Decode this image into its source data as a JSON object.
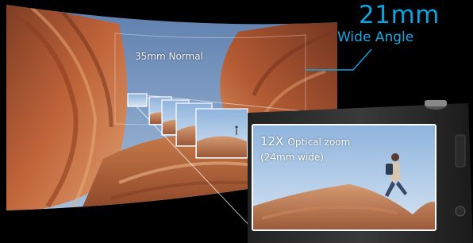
{
  "wide_angle": {
    "focal": "21mm",
    "label": "Wide Angle"
  },
  "normal": {
    "label": "35mm Normal"
  },
  "zoom": {
    "magnification": "12X",
    "label": "Optical zoom",
    "wide_note": "(24mm wide)"
  },
  "colors": {
    "accent": "#0aa3df",
    "background": "#000000"
  }
}
